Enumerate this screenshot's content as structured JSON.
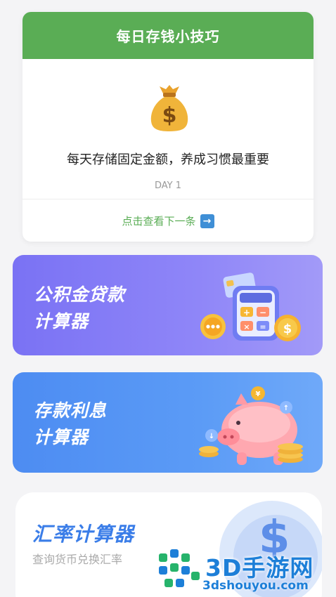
{
  "tip_card": {
    "header": "每日存钱小技巧",
    "text": "每天存储固定金额，养成习惯最重要",
    "day": "DAY 1",
    "next_label": "点击查看下一条"
  },
  "calculators": {
    "fund_loan": {
      "line1": "公积金贷款",
      "line2": "计算器"
    },
    "deposit_interest": {
      "line1": "存款利息",
      "line2": "计算器"
    }
  },
  "exchange": {
    "title": "汇率计算器",
    "subtitle": "查询货币兑换汇率"
  },
  "watermark": {
    "brand": "3D手游网",
    "url": "3dshouyou.com"
  },
  "colors": {
    "tip_green": "#5aad55",
    "fund_purple": "#7a72f4",
    "deposit_blue": "#4d8cf2",
    "exchange_blue": "#3a7de8",
    "watermark_blue": "#1d7fd8"
  }
}
